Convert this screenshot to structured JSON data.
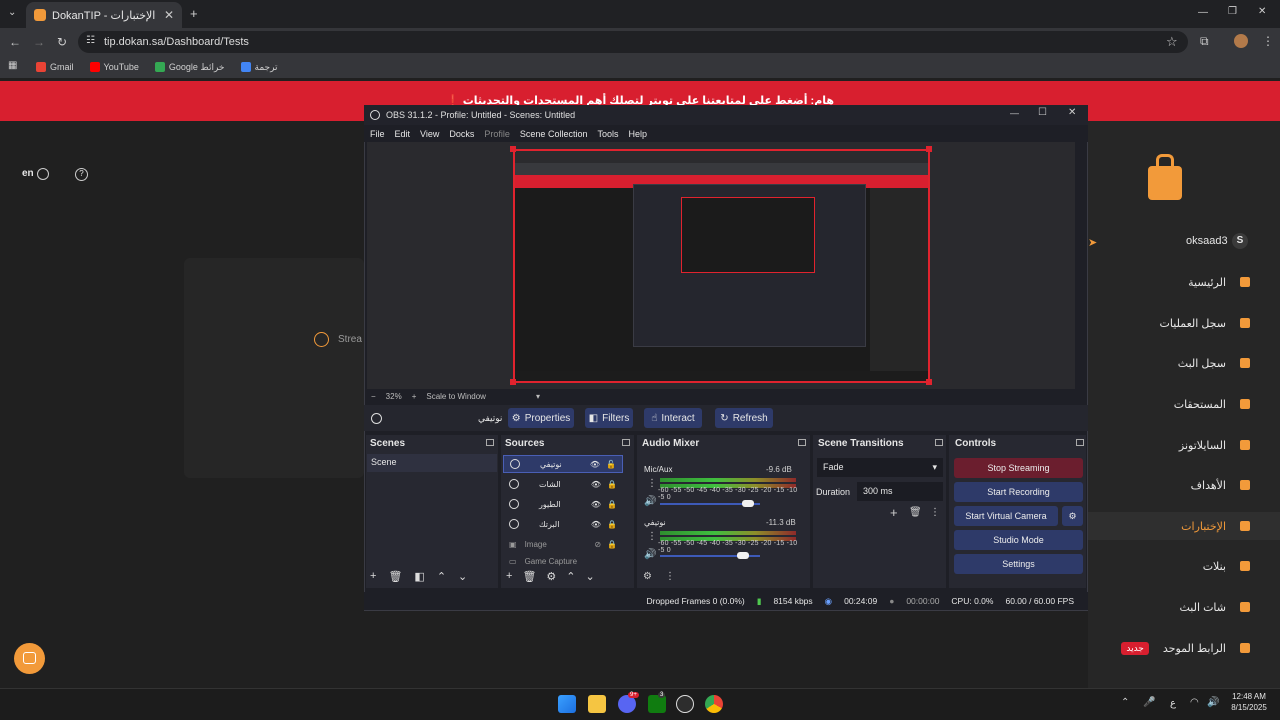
{
  "browser": {
    "tab_title": "DokanTIP - الإختبارات",
    "url": "tip.dokan.sa/Dashboard/Tests",
    "bookmarks": [
      {
        "label": "Gmail",
        "icon": "gmail-icon",
        "color": "#ea4335"
      },
      {
        "label": "YouTube",
        "icon": "youtube-icon",
        "color": "#ff0000"
      },
      {
        "label": "Google خرائط",
        "icon": "maps-icon",
        "color": "#34a853"
      },
      {
        "label": "ترجمة",
        "icon": "translate-icon",
        "color": "#4285f4"
      }
    ]
  },
  "site": {
    "banner_text": "❗ هام: أضغط على لمتابعتنا على تويتر لتصلك أهم المستجدات والتحديثات",
    "lang_label": "en",
    "username": "oksaad3",
    "user_initial": "S",
    "stream_text": "Strea",
    "nav": [
      {
        "label": "الرئيسية",
        "icon": "home-icon"
      },
      {
        "label": "سجل العمليات",
        "icon": "dollar-icon"
      },
      {
        "label": "سجل البث",
        "icon": "broadcast-icon"
      },
      {
        "label": "المستحقات",
        "icon": "wallet-icon"
      },
      {
        "label": "السايلاتونز",
        "icon": "document-icon"
      },
      {
        "label": "الأهداف",
        "icon": "pie-icon"
      },
      {
        "label": "الإختبارات",
        "icon": "test-icon"
      },
      {
        "label": "بنلات",
        "icon": "panel-icon"
      },
      {
        "label": "شات البث",
        "icon": "chat-icon"
      },
      {
        "label": "الرابط الموحد",
        "icon": "link-icon",
        "badge": "جديد"
      }
    ],
    "accent": "#f29a3a",
    "banner_color": "#d81f2f"
  },
  "obs": {
    "title": "OBS 31.1.2 - Profile: Untitled - Scenes: Untitled",
    "menu": [
      "File",
      "Edit",
      "View",
      "Docks",
      "Profile",
      "Scene Collection",
      "Tools",
      "Help"
    ],
    "zoom": "32%",
    "zoom_mode": "Scale to Window",
    "selected_source": "نوتيفي",
    "source_toolbar": [
      "Properties",
      "Filters",
      "Interact",
      "Refresh"
    ],
    "docks": {
      "scenes": "Scenes",
      "sources": "Sources",
      "mixer": "Audio Mixer",
      "transitions": "Scene Transitions",
      "controls": "Controls"
    },
    "scenes": [
      "Scene"
    ],
    "sources": [
      "نوتيفي",
      "الشات",
      "الطيور",
      "البرتك",
      "Image",
      "Game Capture"
    ],
    "mixer": [
      {
        "name": "Mic/Aux",
        "db": "-9.6 dB"
      },
      {
        "name": "نوتيفي",
        "db": "-11.3 dB"
      }
    ],
    "meter_scale": "-60 -55 -50 -45 -40 -35 -30 -25 -20 -15 -10 -5 0",
    "transition": "Fade",
    "duration_label": "Duration",
    "duration_value": "300 ms",
    "controls": [
      {
        "label": "Stop Streaming",
        "color": "#6b1e2e"
      },
      {
        "label": "Start Recording",
        "color": "#2e3a69"
      },
      {
        "label": "Start Virtual Camera",
        "color": "#2e3a69"
      },
      {
        "label": "Studio Mode",
        "color": "#2e3a69"
      },
      {
        "label": "Settings",
        "color": "#2e3a69"
      }
    ],
    "status": {
      "dropped": "Dropped Frames 0 (0.0%)",
      "bitrate": "8154 kbps",
      "stream_time": "00:24:09",
      "rec_time": "00:00:00",
      "cpu": "CPU: 0.0%",
      "fps": "60.00 / 60.00 FPS"
    }
  },
  "taskbar": {
    "time": "12:48 AM",
    "date": "8/15/2025",
    "lang": "ع",
    "discord_badge": "9+",
    "xbox_badge": "3"
  }
}
